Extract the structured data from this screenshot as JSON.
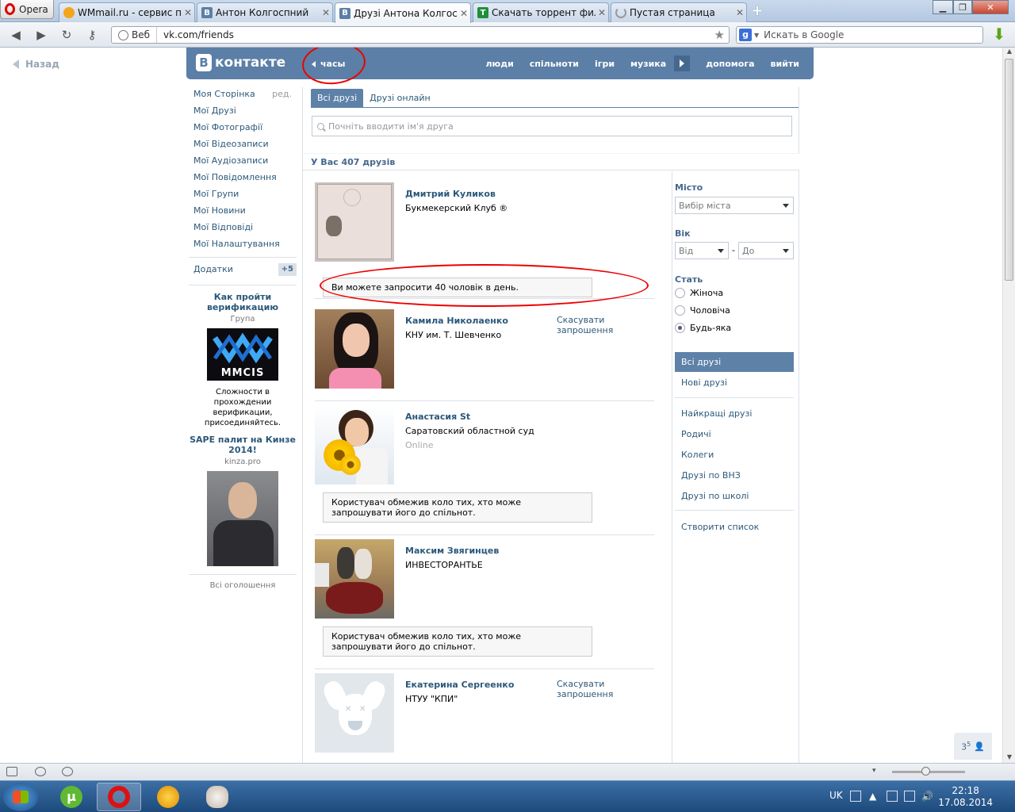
{
  "browser": {
    "menu_label": "Opera",
    "tabs": [
      {
        "title": "WMmail.ru - сервис п...",
        "icon": "wmmail-favicon"
      },
      {
        "title": "Антон Колгоспний",
        "icon": "vk-favicon"
      },
      {
        "title": "Друзі Антона Колгосп...",
        "icon": "vk-favicon"
      },
      {
        "title": "Скачать торрент филь...",
        "icon": "torrent-favicon"
      },
      {
        "title": "Пустая страница",
        "icon": "loading-icon"
      }
    ],
    "address_label": "Веб",
    "url": "vk.com/friends",
    "search_placeholder": "Искать в Google"
  },
  "page": {
    "back_label": "Назад",
    "header": {
      "logo": "контакте",
      "logo_letter": "В",
      "status": "часы",
      "menu": [
        "люди",
        "спільноти",
        "ігри",
        "музика",
        "допомога",
        "вийти"
      ]
    },
    "leftnav": {
      "items": [
        "Моя Сторінка",
        "Мої Друзі",
        "Мої Фотографії",
        "Мої Відеозаписи",
        "Мої Аудіозаписи",
        "Мої Повідомлення",
        "Мої Групи",
        "Мої Новини",
        "Мої Відповіді",
        "Мої Налаштування"
      ],
      "edit": "ред.",
      "apps_label": "Додатки",
      "apps_badge": "+5"
    },
    "ads": [
      {
        "title": "Как пройти верификацию",
        "subtitle": "Група",
        "image_text": "MMCIS",
        "text": "Сложности в прохождении верификации, присоединяйтесь."
      },
      {
        "title": "SAPE палит на Кинзе 2014!",
        "subtitle": "kinza.pro"
      }
    ],
    "all_ads": "Всі оголошення",
    "tabs": [
      "Всі друзі",
      "Друзі онлайн"
    ],
    "search_placeholder": "Почніть вводити ім'я друга",
    "friends_count": "У Вас 407 друзів",
    "friends": [
      {
        "name": "Дмитрий Куликов",
        "info": "Букмекерский Клуб ®",
        "online": "",
        "action": "",
        "notice": "Ви можете запросити 40 чоловік в день."
      },
      {
        "name": "Камила Николаенко",
        "info": "КНУ им. Т. Шевченко",
        "online": "",
        "action": "Скасувати запрошення",
        "notice": ""
      },
      {
        "name": "Анастасия St",
        "info": "Саратовский областной суд",
        "online": "Online",
        "action": "",
        "notice": "Користувач обмежив коло тих, хто може запрошувати його до спільнот."
      },
      {
        "name": "Максим Звягинцев",
        "info": "ИНВЕСТОРАНТЬЕ",
        "online": "",
        "action": "",
        "notice": "Користувач обмежив коло тих, хто може запрошувати його до спільнот."
      },
      {
        "name": "Екатерина Сергеенко",
        "info": "НТУУ \"КПИ\"",
        "online": "",
        "action": "Скасувати запрошення",
        "notice": ""
      }
    ],
    "filters": {
      "city_label": "Місто",
      "city_select": "Вибір міста",
      "age_label": "Вік",
      "age_from": "Від",
      "age_dash": "-",
      "age_to": "До",
      "sex_label": "Стать",
      "sex_options": [
        "Жіноча",
        "Чоловіча",
        "Будь-яка"
      ],
      "sex_selected": "Будь-яка"
    },
    "right_menu": [
      "Всі друзі",
      "Нові друзі",
      "Найкращі друзі",
      "Родичі",
      "Колеги",
      "Друзі по ВНЗ",
      "Друзі по школі",
      "Створити список"
    ],
    "notifications_count": "3",
    "notifications_sup": "5"
  },
  "taskbar": {
    "lang": "UK",
    "time": "22:18",
    "date": "17.08.2014"
  },
  "colors": {
    "vk_blue": "#5b7fa6",
    "link": "#2b587a",
    "annotation_red": "#e00000"
  }
}
